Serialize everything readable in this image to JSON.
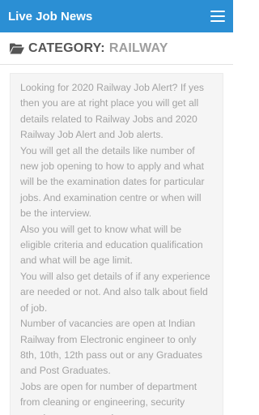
{
  "header": {
    "site_title": "Live Job News",
    "menu_icon": "hamburger-menu-icon",
    "background_color": "#2b8fd4"
  },
  "category": {
    "icon": "folder-open-icon",
    "prefix": "CATEGORY:",
    "name": "RAILWAY"
  },
  "post": {
    "paragraphs": [
      "Looking for 2020 Railway Job Alert? If yes then you are at right place you will get all details related to Railway Jobs and 2020 Railway Job Alert and Job alerts.",
      "You will get all the details like number of new job opening to how to apply and what will be the examination dates for particular jobs. And examination centre or when will be the interview.",
      "Also you will get to know what will be eligible criteria and education qualification and what will be age limit.",
      "You will also get details of if any experience are needed or not. And also talk about field of job.",
      "Number of vacancies are open at Indian Railway from Electronic engineer to only 8th, 10th, 12th pass out or any Graduates and Post Graduates.",
      "Jobs are open for number of department from cleaning or engineering, security guard, computer engineer..."
    ]
  }
}
